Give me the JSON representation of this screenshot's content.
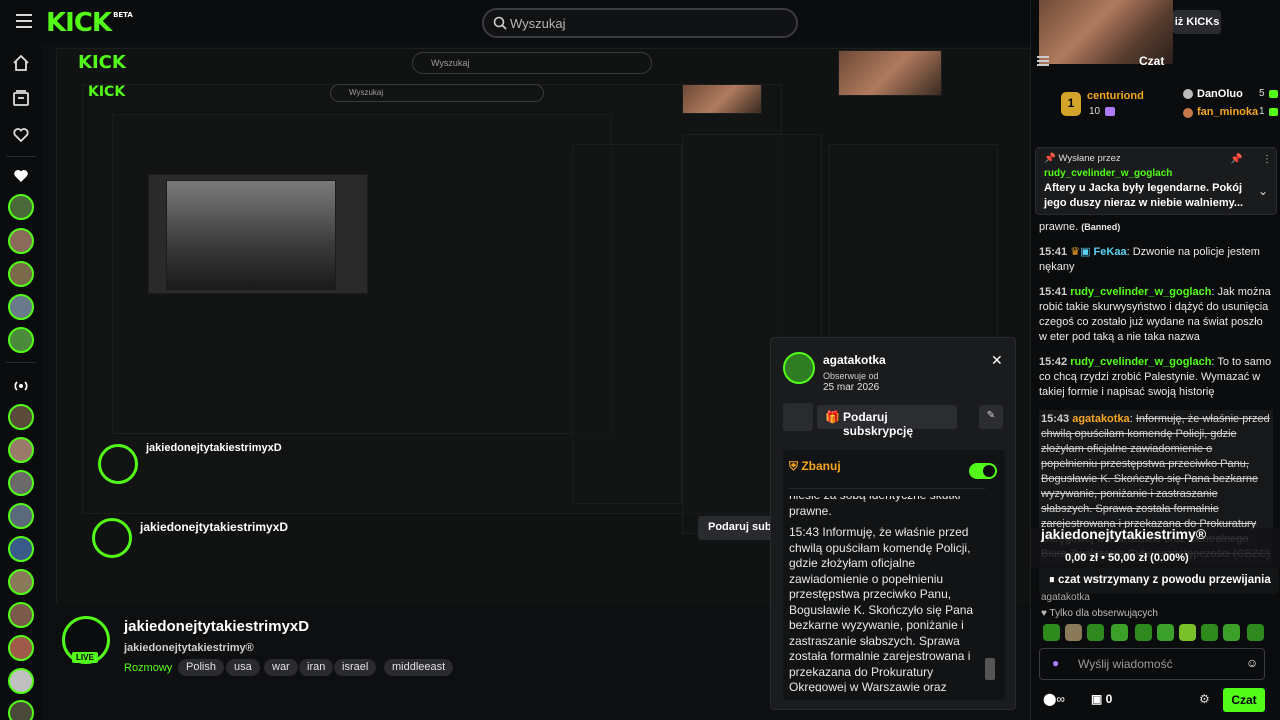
{
  "header": {
    "logo": "KICK",
    "logo_badge": "BETA",
    "search_placeholder": "Wyszukaj"
  },
  "sidebar": {
    "icons": [
      "home-icon",
      "browse-icon",
      "following-icon"
    ],
    "following_label_icon": "heart-icon"
  },
  "stream": {
    "channel_name": "jakiedonejtytakiestrimyxD",
    "channel_sub": "jakiedonejtytakiestrimy®",
    "live_label": "LIVE",
    "category": "Rozmowy",
    "tags": [
      "Polish",
      "usa",
      "war",
      "iran",
      "israel",
      "middleeast"
    ]
  },
  "popup": {
    "username": "agatakotka",
    "follows_label": "Obserwuje od",
    "follows_date": "25 mar 2026",
    "gift_button": "Podaruj subskrypcję",
    "banned_label": "Zbanuj",
    "message_top": "niesie za sobą identyczne skutki prawne.",
    "message": "15:43 Informuję, że właśnie przed chwilą opuściłam komendę Policji, gdzie złożyłam oficjalne zawiadomienie o popełnieniu przestępstwa przeciwko Panu, Bogusławie K. Skończyło się Pana bezkarne wyzywanie, poniżanie i zastraszanie słabszych. Sprawa została formalnie zarejestrowana i przekazana do Prokuratury Okręgowej w Warszawie oraz Centralnego Biura Zwalczania Cyberprzestępczości (CBZC)."
  },
  "chat": {
    "kicks_button": "iż KICKs",
    "title": "Czat",
    "leaders": [
      {
        "rank": "1",
        "name": "centuriond",
        "count": "10"
      },
      {
        "rank": "",
        "name": "DanOluo",
        "count": "5"
      },
      {
        "rank": "",
        "name": "fan_minoka",
        "count": "1"
      }
    ],
    "pinned": {
      "label": "Wysłane przez",
      "user": "rudy_cvelinder_w_goglach",
      "text": "Aftery u Jacka były legendarne. Pokój jego duszy nieraz w niebie walniemy..."
    },
    "banned_tail": "prawne.",
    "banned_tag": "(Banned)",
    "messages": [
      {
        "time": "15:41",
        "user": "FeKaa",
        "text": "Dzwonie na policje jestem nękany"
      },
      {
        "time": "15:41",
        "user": "rudy_cvelinder_w_goglach",
        "text": "Jak można robić takie skurwysyństwo i dążyć do usunięcia czegoś co zostało już wydane na świat poszło w eter pod taką a nie taka nazwa"
      },
      {
        "time": "15:42",
        "user": "rudy_cvelinder_w_goglach",
        "text": "To to samo co chcą rzydzi zrobić Palestynie. Wymazać w takiej formie i napisać swoją historię"
      },
      {
        "time": "15:43",
        "user": "agatakotka",
        "text": "Informuję, że właśnie przed chwilą opuściłam komendę Policji, gdzie złożyłam oficjalne zawiadomienie o popełnieniu przestępstwa przeciwko Panu, Bogusławie K. Skończyło się Pana bezkarne wyzywanie, poniżanie i zastraszanie słabszych. Sprawa została formalnie zarejestrowana i przekazana do Prokuratury Okręgowej w Warszawie oraz Centralnego Biura Zwalczania Cyberprzestępczości (CBZC)"
      }
    ],
    "overlay_channel": "jakiedonejtytakiestrimy®",
    "overlay_amount": "0,00 zł • 50,00 zł (0.00%)",
    "paused": "czat wstrzymany z powodu przewijania",
    "next_user": "agatakotka",
    "followers_only": "Tylko dla obserwujących",
    "input_placeholder": "Wyślij wiadomość",
    "points": "0",
    "chat_button": "Czat"
  }
}
